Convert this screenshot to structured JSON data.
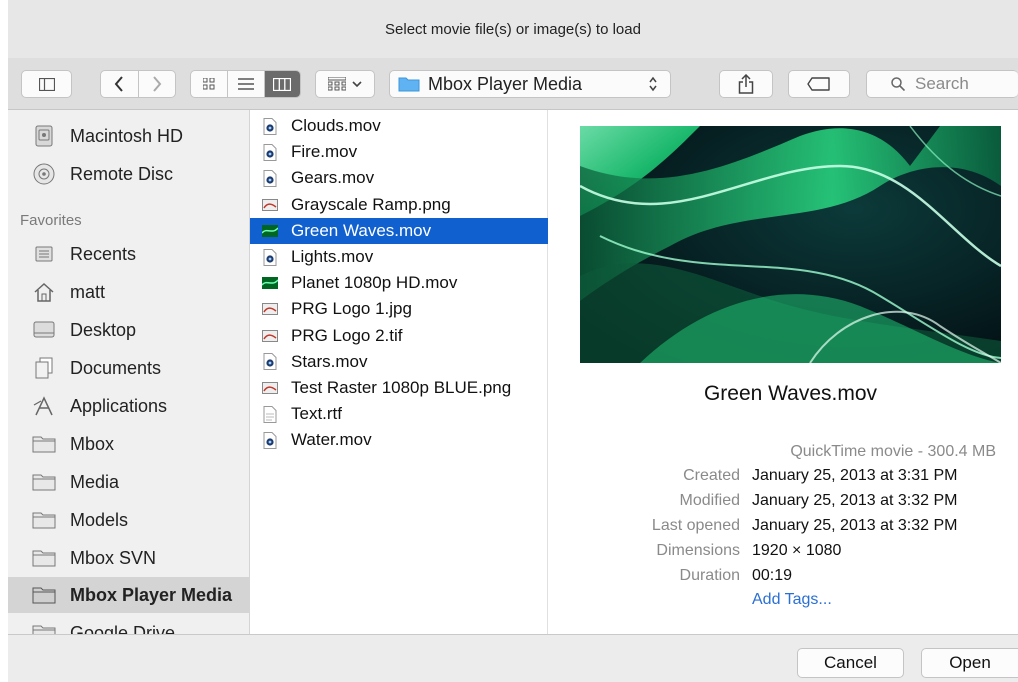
{
  "window": {
    "title": "Select movie file(s) or image(s) to load"
  },
  "toolbar": {
    "location": "Mbox Player Media",
    "search_placeholder": "Search"
  },
  "sidebar": {
    "devices": [
      {
        "label": "Macintosh HD",
        "icon": "hard-drive-icon"
      },
      {
        "label": "Remote Disc",
        "icon": "disc-icon"
      }
    ],
    "favorites_heading": "Favorites",
    "favorites": [
      {
        "label": "Recents",
        "icon": "recents-icon"
      },
      {
        "label": "matt",
        "icon": "home-icon"
      },
      {
        "label": "Desktop",
        "icon": "desktop-icon"
      },
      {
        "label": "Documents",
        "icon": "documents-icon"
      },
      {
        "label": "Applications",
        "icon": "applications-icon"
      },
      {
        "label": "Mbox",
        "icon": "folder-icon"
      },
      {
        "label": "Media",
        "icon": "folder-icon"
      },
      {
        "label": "Models",
        "icon": "folder-icon"
      },
      {
        "label": "Mbox SVN",
        "icon": "folder-icon"
      },
      {
        "label": "Mbox Player Media",
        "icon": "folder-icon",
        "selected": true
      },
      {
        "label": "Google Drive",
        "icon": "folder-icon"
      }
    ]
  },
  "files": [
    {
      "name": "Clouds.mov",
      "icon": "quicktime-icon"
    },
    {
      "name": "Fire.mov",
      "icon": "quicktime-icon"
    },
    {
      "name": "Gears.mov",
      "icon": "quicktime-icon"
    },
    {
      "name": "Grayscale Ramp.png",
      "icon": "image-icon"
    },
    {
      "name": "Green Waves.mov",
      "icon": "movie-thumb-icon",
      "selected": true
    },
    {
      "name": "Lights.mov",
      "icon": "quicktime-icon"
    },
    {
      "name": "Planet 1080p HD.mov",
      "icon": "movie-thumb-icon"
    },
    {
      "name": "PRG Logo 1.jpg",
      "icon": "image-icon"
    },
    {
      "name": "PRG Logo 2.tif",
      "icon": "image-icon"
    },
    {
      "name": "Stars.mov",
      "icon": "quicktime-icon"
    },
    {
      "name": "Test Raster 1080p BLUE.png",
      "icon": "image-icon"
    },
    {
      "name": "Text.rtf",
      "icon": "text-document-icon"
    },
    {
      "name": "Water.mov",
      "icon": "quicktime-icon"
    }
  ],
  "preview": {
    "name": "Green Waves.mov",
    "kind": "QuickTime movie - 300.4 MB",
    "meta": [
      {
        "label": "Created",
        "value": "January 25, 2013 at 3:31 PM"
      },
      {
        "label": "Modified",
        "value": "January 25, 2013 at 3:32 PM"
      },
      {
        "label": "Last opened",
        "value": "January 25, 2013 at 3:32 PM"
      },
      {
        "label": "Dimensions",
        "value": "1920 × 1080"
      },
      {
        "label": "Duration",
        "value": "00:19"
      }
    ],
    "add_tags": "Add Tags..."
  },
  "buttons": {
    "cancel": "Cancel",
    "open": "Open"
  },
  "colors": {
    "selection": "#1060d0",
    "link": "#2a6fd6",
    "accent_green": "#3cff9a"
  }
}
